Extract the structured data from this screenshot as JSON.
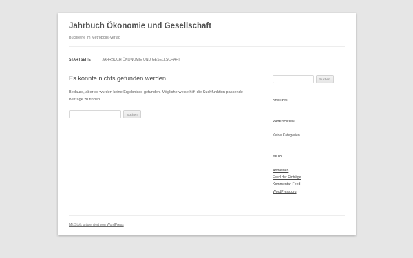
{
  "header": {
    "title": "Jahrbuch Ökonomie und Gesellschaft",
    "description": "Buchreihe im Metropolis-Verlag"
  },
  "nav": {
    "items": [
      {
        "label": "Startseite"
      },
      {
        "label": "Jahrbuch Ökonomie und Gesellschaft"
      }
    ]
  },
  "main": {
    "title": "Es konnte nichts gefunden werden.",
    "text": "Bedaure, aber es wurden keine Ergebnisse gefunden. Möglicherweise hilft die Suchfunktion passende Beiträge zu finden.",
    "search": {
      "value": "",
      "button_label": "Suchen"
    }
  },
  "sidebar": {
    "search": {
      "value": "",
      "button_label": "Suchen"
    },
    "archive_title": "Archive",
    "categories_title": "Kategorien",
    "categories_empty": "Keine Kategorien",
    "meta_title": "Meta",
    "meta_links": [
      {
        "label": "Anmelden"
      },
      {
        "label": "Feed der Einträge"
      },
      {
        "label": "Kommentar-Feed"
      },
      {
        "label": "WordPress.org"
      }
    ]
  },
  "footer": {
    "credit": "Mit Stolz präsentiert von WordPress"
  },
  "colors": {
    "background": "#e6e6e6",
    "page": "#ffffff",
    "text": "#444444",
    "link": "#4a4a4a"
  }
}
